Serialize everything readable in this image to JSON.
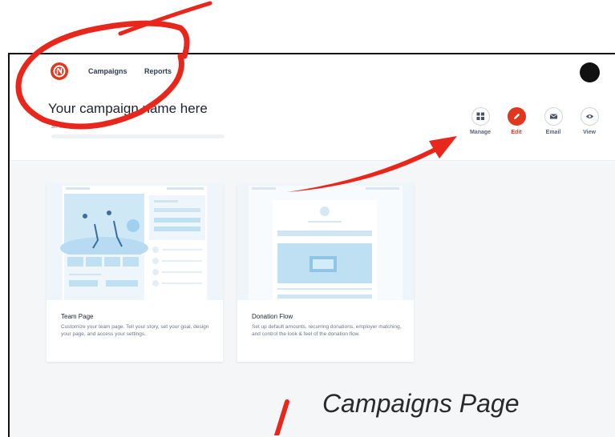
{
  "nav": {
    "links": [
      "Campaigns",
      "Reports"
    ]
  },
  "campaign": {
    "name": "Your campaign name here",
    "progress_text": "$0 of $500 Goal",
    "progress_fraction": 0
  },
  "actions": [
    {
      "label": "Manage",
      "icon": "grid-icon"
    },
    {
      "label": "Edit",
      "icon": "pencil-icon"
    },
    {
      "label": "Email",
      "icon": "envelope-icon"
    },
    {
      "label": "View",
      "icon": "eye-icon"
    }
  ],
  "cards": [
    {
      "title": "Team Page",
      "description": "Customize your team page. Tell your story, set your goal, design your page, and access your settings."
    },
    {
      "title": "Donation Flow",
      "description": "Set up default amounts, recurring donations, employer matching, and control the look & feel of the donation flow."
    }
  ],
  "annotation": {
    "text": "Campaigns Page"
  },
  "colors": {
    "brand": "#e0371f",
    "annotation_red": "#e8261c",
    "background": "#f5f6f8"
  }
}
